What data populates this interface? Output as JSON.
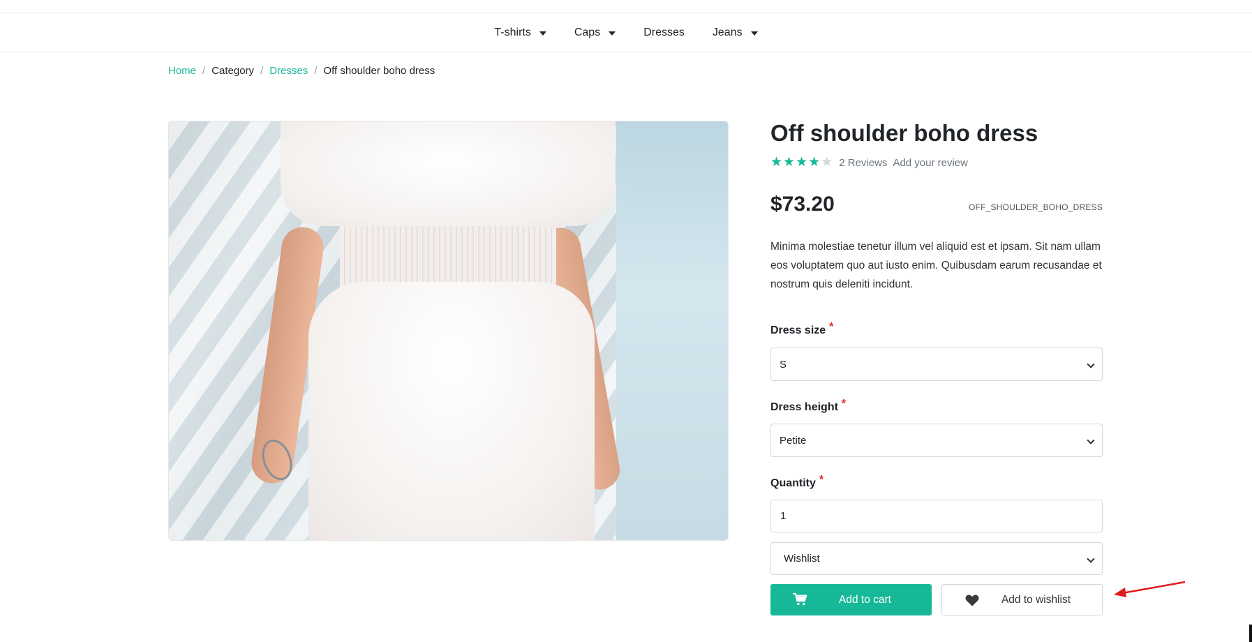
{
  "nav": {
    "items": [
      {
        "label": "T-shirts",
        "dropdown": true
      },
      {
        "label": "Caps",
        "dropdown": true
      },
      {
        "label": "Dresses",
        "dropdown": false
      },
      {
        "label": "Jeans",
        "dropdown": true
      }
    ]
  },
  "breadcrumb": {
    "home": "Home",
    "category": "Category",
    "dresses": "Dresses",
    "current": "Off shoulder boho dress",
    "separator": "/"
  },
  "product": {
    "title": "Off shoulder boho dress",
    "rating": 4,
    "rating_max": 5,
    "reviews_text": "2 Reviews",
    "add_review_text": "Add your review",
    "price": "$73.20",
    "sku": "OFF_SHOULDER_BOHO_DRESS",
    "description": "Minima molestiae tenetur illum vel aliquid est et ipsam. Sit nam ullam eos voluptatem quo aut iusto enim. Quibusdam earum recusandae et nostrum quis deleniti incidunt."
  },
  "form": {
    "size_label": "Dress size",
    "size_value": "S",
    "height_label": "Dress height",
    "height_value": "Petite",
    "quantity_label": "Quantity",
    "quantity_value": "1",
    "wishlist_value": "Wishlist",
    "required_mark": "*"
  },
  "buttons": {
    "add_to_cart": "Add to cart",
    "add_to_wishlist": "Add to wishlist"
  },
  "colors": {
    "accent": "#17b897",
    "required": "#e02020",
    "annotation": "#e01b1b"
  },
  "icons": {
    "cart": "shopping-cart-icon",
    "heart": "heart-icon",
    "star": "star-icon",
    "caret": "caret-down-icon"
  }
}
